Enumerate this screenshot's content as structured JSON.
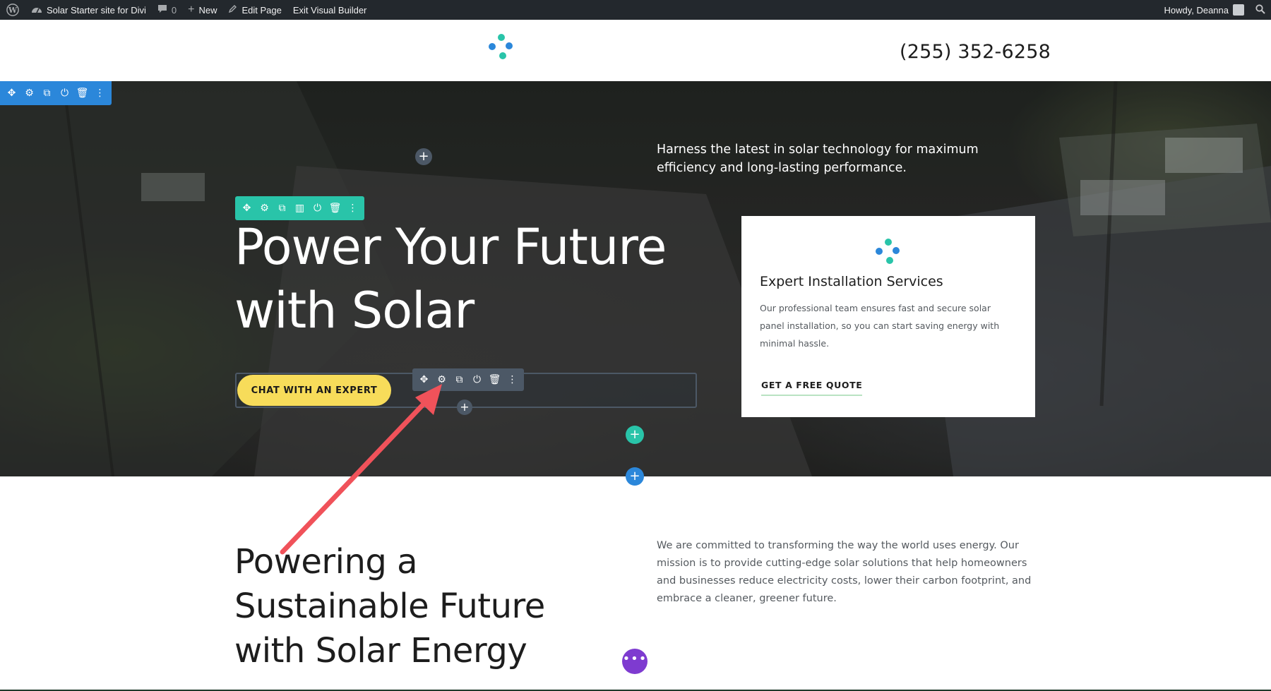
{
  "admin_bar": {
    "site_name": "Solar Starter site for Divi",
    "comments_count": "0",
    "new_label": "New",
    "edit_page_label": "Edit Page",
    "exit_builder_label": "Exit Visual Builder",
    "greeting": "Howdy, Deanna"
  },
  "header": {
    "phone": "(255) 352-6258"
  },
  "hero": {
    "tagline": "Harness the latest in solar technology for maximum efficiency and long-lasting performance.",
    "title_line1": "Power Your Future",
    "title_line2": "with Solar",
    "cta_label": "CHAT WITH AN EXPERT"
  },
  "card": {
    "title": "Expert Installation Services",
    "text": "Our professional team ensures fast and secure solar panel installation, so you can start saving energy with minimal hassle.",
    "link_label": "GET A FREE QUOTE"
  },
  "mission": {
    "title_line1": "Powering a",
    "title_line2": "Sustainable Future",
    "title_line3": "with Solar Energy",
    "text": "We are committed to transforming the way the world uses energy. Our mission is to provide cutting-edge solar solutions that help homeowners and businesses reduce electricity costs, lower their carbon footprint, and embrace a cleaner, greener future."
  },
  "builder": {
    "add_symbol": "+",
    "more_symbol": "•••"
  },
  "colors": {
    "section_toolbar": "#2b87da",
    "row_toolbar": "#29c4a9",
    "module_toolbar": "#4c5866",
    "cta_yellow": "#f7dc5a",
    "annotation_arrow": "#f0525a",
    "builder_menu": "#7e3bd0",
    "logo_blue": "#2b87da",
    "logo_teal": "#29c4a9"
  }
}
